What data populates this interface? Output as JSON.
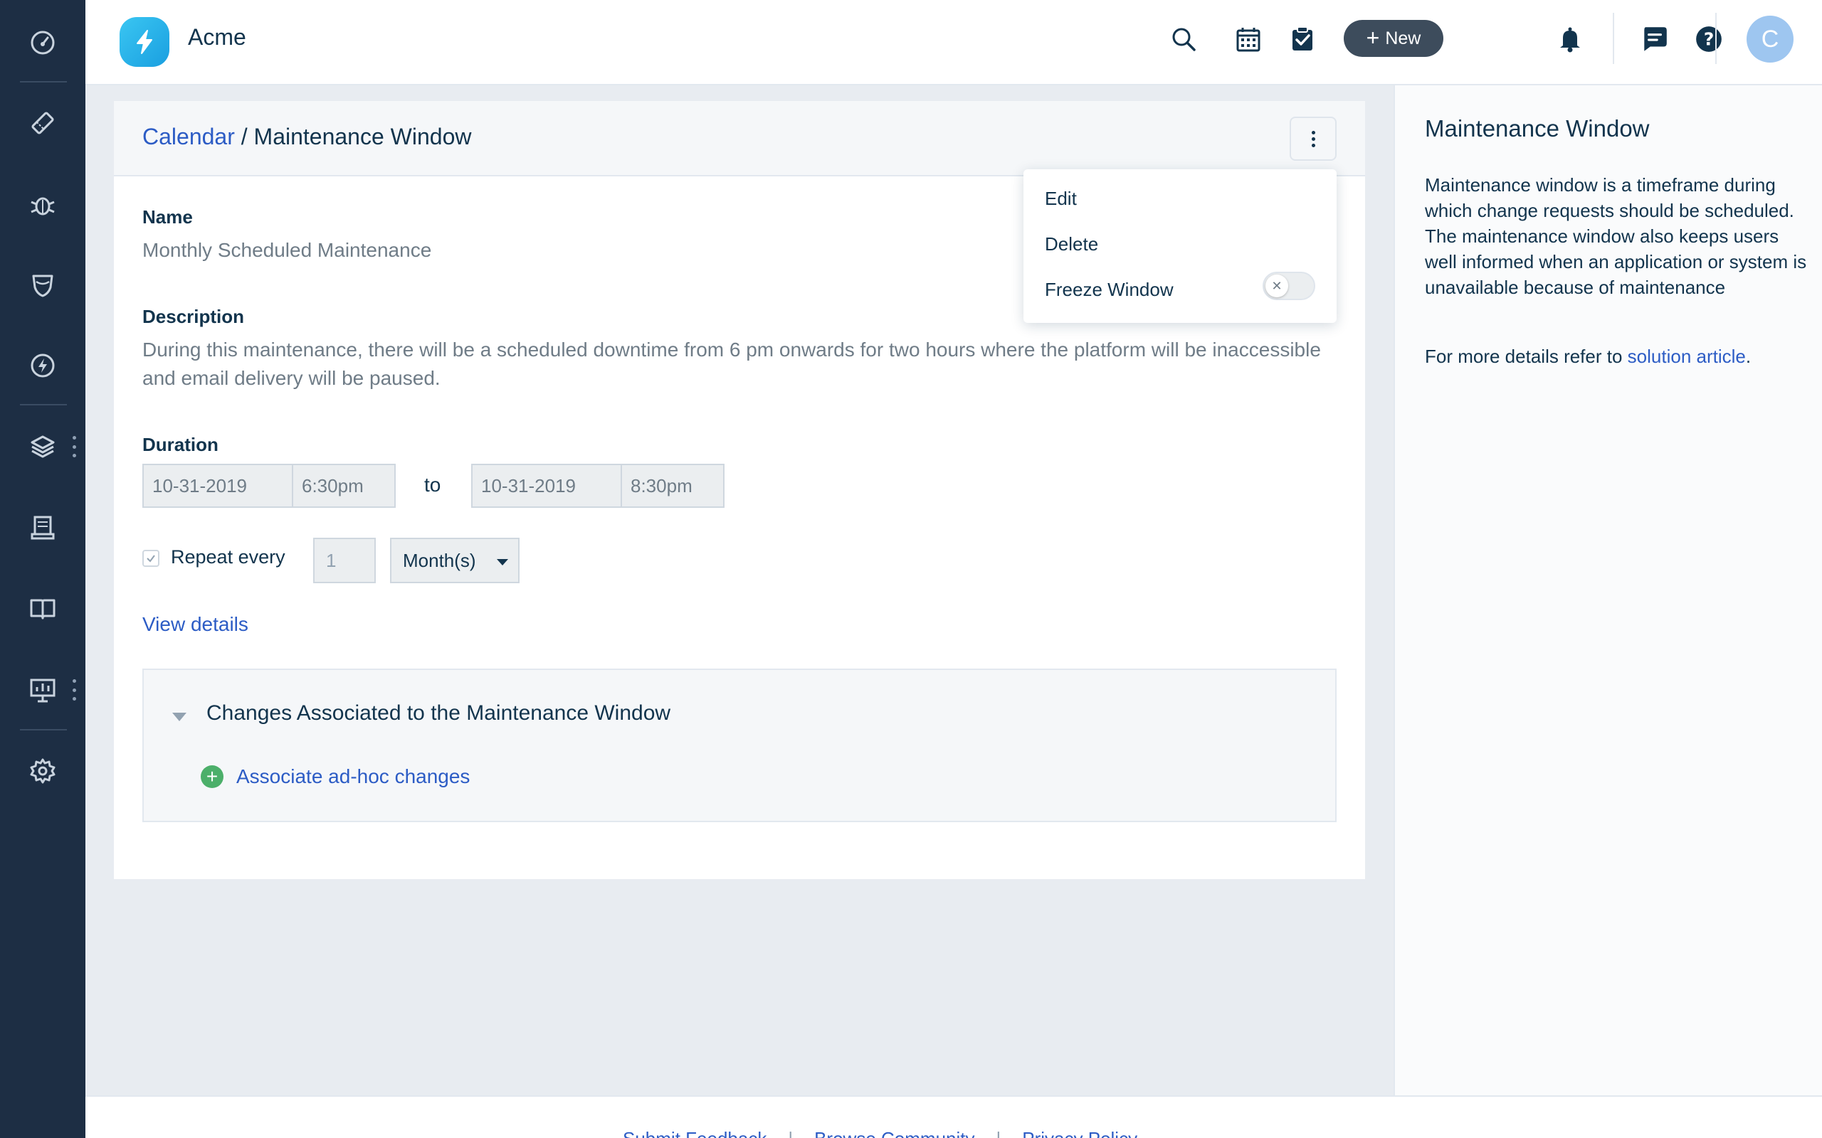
{
  "app": {
    "brand": "Acme"
  },
  "header": {
    "new_label": "New",
    "avatar_initial": "C"
  },
  "breadcrumb": {
    "parent": "Calendar",
    "separator": " / ",
    "current": "Maintenance Window"
  },
  "form": {
    "name_label": "Name",
    "name_value": "Monthly Scheduled Maintenance",
    "description_label": "Description",
    "description_value": "During this maintenance, there will be a scheduled downtime from 6 pm onwards for two hours where the platform will be inaccessible and email delivery will be paused.",
    "duration_label": "Duration",
    "start_date": "10-31-2019",
    "start_time": "6:30pm",
    "to_label": "to",
    "end_date": "10-31-2019",
    "end_time": "8:30pm",
    "repeat_label": "Repeat every",
    "repeat_checked": true,
    "repeat_count": "1",
    "repeat_unit": "Month(s)",
    "view_details": "View details"
  },
  "changes": {
    "title": "Changes Associated to the Maintenance Window",
    "associate_label": "Associate ad-hoc changes"
  },
  "menu": {
    "items": [
      {
        "label": "Edit"
      },
      {
        "label": "Delete"
      },
      {
        "label": "Freeze Window"
      }
    ],
    "freeze_enabled": false
  },
  "help": {
    "title": "Maintenance Window",
    "body": "Maintenance window is a timeframe during which change requests should be scheduled. The maintenance window also keeps users well informed when an application or system is unavailable because of maintenance",
    "more_prefix": "For more details refer to ",
    "more_link": "solution article",
    "more_suffix": "."
  },
  "footer": {
    "links": [
      "Submit Feedback",
      "Browse Community",
      "Privacy Policy"
    ],
    "separator": "|"
  },
  "colors": {
    "nav_bg": "#1d2e44",
    "link": "#2c5cc5",
    "new_button": "#3d4c5c",
    "add_icon": "#4caf6a",
    "logo": "#1a9fe0"
  },
  "icons": {
    "nav": [
      "dashboard-icon",
      "tickets-icon",
      "problems-icon",
      "changes-icon",
      "releases-icon",
      "assets-icon",
      "inventory-icon",
      "solutions-icon",
      "analytics-icon",
      "settings-icon"
    ],
    "header": [
      "search-icon",
      "calendar-icon",
      "tasks-icon",
      "bell-icon",
      "chat-icon",
      "help-icon",
      "info-icon"
    ]
  }
}
